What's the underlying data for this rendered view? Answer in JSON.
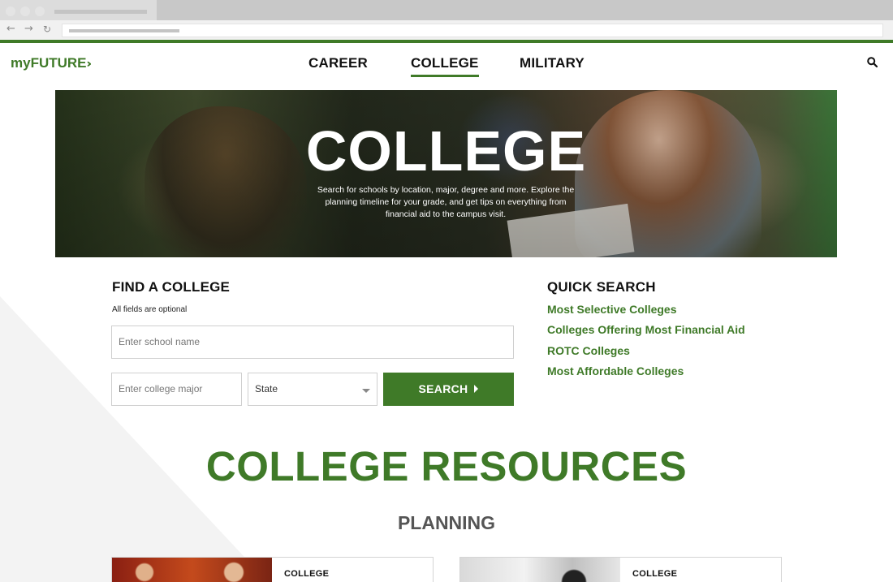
{
  "site": {
    "logo": "myFUTURE",
    "nav": [
      "CAREER",
      "COLLEGE",
      "MILITARY"
    ],
    "active_nav": "COLLEGE",
    "accent_color": "#3f7a28"
  },
  "hero": {
    "title": "COLLEGE",
    "subtitle": "Search for schools by location, major, degree and more. Explore the planning timeline for your grade, and get tips on everything from financial aid to the campus visit."
  },
  "find_college": {
    "heading": "FIND A COLLEGE",
    "note": "All fields are optional",
    "school_placeholder": "Enter school name",
    "major_placeholder": "Enter college major",
    "state_value": "State",
    "search_label": "SEARCH"
  },
  "quick_search": {
    "heading": "QUICK SEARCH",
    "links": [
      "Most Selective Colleges",
      "Colleges Offering Most Financial Aid",
      "ROTC Colleges",
      "Most Affordable Colleges"
    ]
  },
  "resources": {
    "title": "COLLEGE RESOURCES",
    "subtitle": "PLANNING",
    "cards": [
      {
        "label": "COLLEGE"
      },
      {
        "label": "COLLEGE"
      }
    ]
  },
  "icons": {
    "search": "search-icon",
    "back": "back-arrow-icon",
    "forward": "forward-arrow-icon",
    "reload": "reload-icon"
  }
}
